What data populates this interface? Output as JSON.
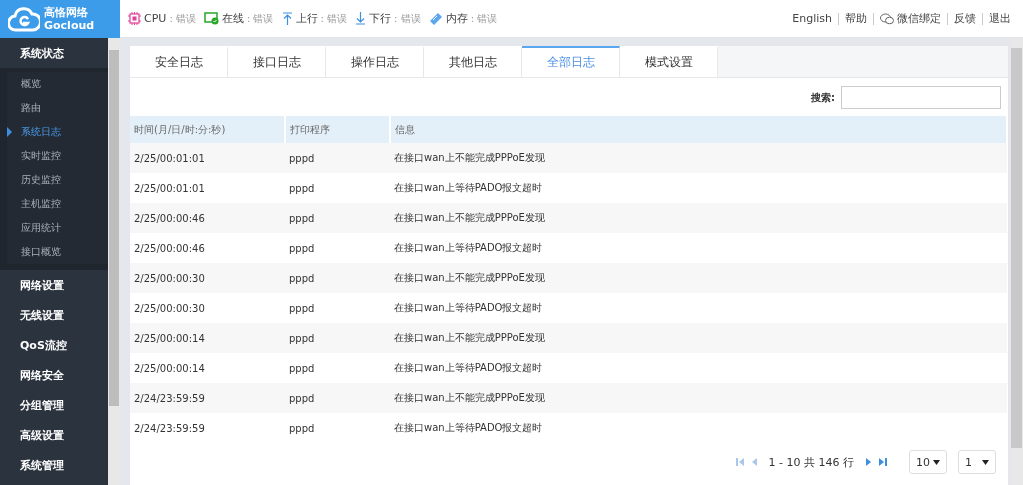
{
  "logo": {
    "cn": "高恪网络",
    "en": "Gocloud"
  },
  "status": [
    {
      "kind": "cpu",
      "label": "CPU",
      "value": ": 错误"
    },
    {
      "kind": "online",
      "label": "在线",
      "value": ": 错误"
    },
    {
      "kind": "up",
      "label": "上行",
      "value": ": 错误"
    },
    {
      "kind": "down",
      "label": "下行",
      "value": ": 错误"
    },
    {
      "kind": "memory",
      "label": "内存",
      "value": ": 错误"
    }
  ],
  "top_links": [
    {
      "kind": "text",
      "label": "English"
    },
    {
      "kind": "text",
      "label": "帮助"
    },
    {
      "kind": "wechat",
      "label": "微信绑定"
    },
    {
      "kind": "text",
      "label": "反馈"
    },
    {
      "kind": "text",
      "label": "退出"
    }
  ],
  "sidebar": {
    "items": [
      {
        "label": "系统状态",
        "expanded": true,
        "children": [
          {
            "label": "概览",
            "selected": false
          },
          {
            "label": "路由",
            "selected": false
          },
          {
            "label": "系统日志",
            "selected": true
          },
          {
            "label": "实时监控",
            "selected": false
          },
          {
            "label": "历史监控",
            "selected": false
          },
          {
            "label": "主机监控",
            "selected": false
          },
          {
            "label": "应用统计",
            "selected": false
          },
          {
            "label": "接口概览",
            "selected": false
          }
        ]
      },
      {
        "label": "网络设置"
      },
      {
        "label": "无线设置"
      },
      {
        "label": "QoS流控"
      },
      {
        "label": "网络安全"
      },
      {
        "label": "分组管理"
      },
      {
        "label": "高级设置"
      },
      {
        "label": "系统管理"
      }
    ]
  },
  "tabs": [
    {
      "label": "安全日志",
      "selected": false
    },
    {
      "label": "接口日志",
      "selected": false
    },
    {
      "label": "操作日志",
      "selected": false
    },
    {
      "label": "其他日志",
      "selected": false
    },
    {
      "label": "全部日志",
      "selected": true
    },
    {
      "label": "模式设置",
      "selected": false
    }
  ],
  "search": {
    "label": "搜索:"
  },
  "table": {
    "columns": [
      "时间(月/日/时:分:秒)",
      "打印程序",
      "信息"
    ],
    "rows": [
      [
        "2/25/00:01:01",
        "pppd",
        "在接口wan上不能完成PPPoE发现"
      ],
      [
        "2/25/00:01:01",
        "pppd",
        "在接口wan上等待PADO报文超时"
      ],
      [
        "2/25/00:00:46",
        "pppd",
        "在接口wan上不能完成PPPoE发现"
      ],
      [
        "2/25/00:00:46",
        "pppd",
        "在接口wan上等待PADO报文超时"
      ],
      [
        "2/25/00:00:30",
        "pppd",
        "在接口wan上不能完成PPPoE发现"
      ],
      [
        "2/25/00:00:30",
        "pppd",
        "在接口wan上等待PADO报文超时"
      ],
      [
        "2/25/00:00:14",
        "pppd",
        "在接口wan上不能完成PPPoE发现"
      ],
      [
        "2/25/00:00:14",
        "pppd",
        "在接口wan上等待PADO报文超时"
      ],
      [
        "2/24/23:59:59",
        "pppd",
        "在接口wan上不能完成PPPoE发现"
      ],
      [
        "2/24/23:59:59",
        "pppd",
        "在接口wan上等待PADO报文超时"
      ]
    ]
  },
  "pagination": {
    "summary": "1 - 10 共 146 行",
    "page_size": "10",
    "page": "1"
  }
}
